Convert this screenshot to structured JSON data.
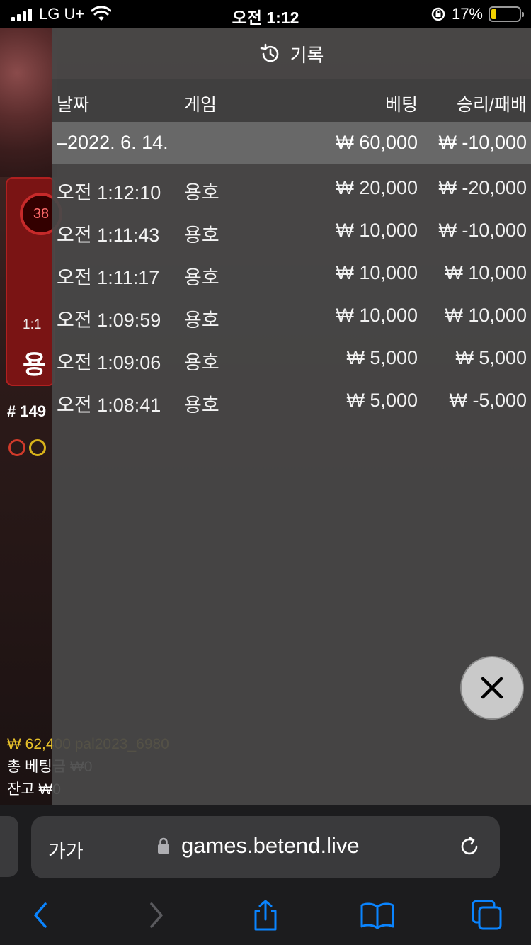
{
  "status_bar": {
    "carrier": "LG U+",
    "time": "오전 1:12",
    "battery": "17%"
  },
  "background": {
    "bet_percent": "38",
    "bet_ratio": "1:1",
    "bet_name": "용",
    "round": "# 149",
    "balance_line": "₩ 62,400 pal2023_6980",
    "total_bet": "총 베팅금 ₩0",
    "balance": "잔고 ₩0"
  },
  "panel": {
    "title": "기록",
    "columns": {
      "date": "날짜",
      "game": "게임",
      "bet": "베팅",
      "result": "승리/패배"
    },
    "date_group": {
      "date": "–2022. 6. 14.",
      "bet": "₩ 60,000",
      "result": "₩ -10,000"
    },
    "rows": [
      {
        "time": "오전 1:12:10",
        "game": "용호",
        "bet": "₩ 20,000",
        "result": "₩ -20,000"
      },
      {
        "time": "오전 1:11:43",
        "game": "용호",
        "bet": "₩ 10,000",
        "result": "₩ -10,000"
      },
      {
        "time": "오전 1:11:17",
        "game": "용호",
        "bet": "₩ 10,000",
        "result": "₩ 10,000"
      },
      {
        "time": "오전 1:09:59",
        "game": "용호",
        "bet": "₩ 10,000",
        "result": "₩ 10,000"
      },
      {
        "time": "오전 1:09:06",
        "game": "용호",
        "bet": "₩ 5,000",
        "result": "₩ 5,000"
      },
      {
        "time": "오전 1:08:41",
        "game": "용호",
        "bet": "₩ 5,000",
        "result": "₩ -5,000"
      }
    ]
  },
  "browser": {
    "text_size_label": "가가",
    "url": "games.betend.live"
  }
}
